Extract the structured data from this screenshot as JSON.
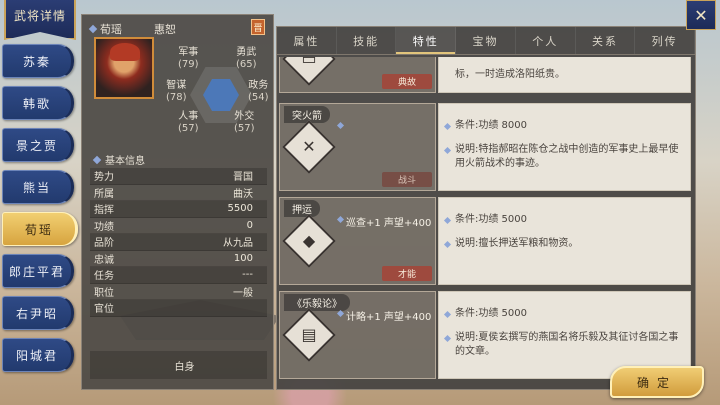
{
  "window": {
    "title": "武将详情"
  },
  "generals": [
    {
      "name": "苏秦",
      "active": false
    },
    {
      "name": "韩歌",
      "active": false
    },
    {
      "name": "景之贾",
      "active": false
    },
    {
      "name": "熊当",
      "active": false
    },
    {
      "name": "荀瑶",
      "active": true
    },
    {
      "name": "郎庄平君",
      "active": false
    },
    {
      "name": "右尹昭",
      "active": false
    },
    {
      "name": "阳城君",
      "active": false
    }
  ],
  "profile": {
    "name": "荀瑶",
    "courtesy_name": "惠恕",
    "state_badge": "晋",
    "stats": {
      "military": {
        "label": "军事",
        "value": "(79)"
      },
      "bravery": {
        "label": "勇武",
        "value": "(65)"
      },
      "strategy": {
        "label": "智谋",
        "value": "(78)"
      },
      "politics": {
        "label": "政务",
        "value": "(54)"
      },
      "personnel": {
        "label": "人事",
        "value": "(57)"
      },
      "diplomacy": {
        "label": "外交",
        "value": "(57)"
      }
    },
    "basic_info_title": "基本信息",
    "attributes": [
      {
        "label": "势力",
        "value": "晋国"
      },
      {
        "label": "所属",
        "value": "曲沃"
      },
      {
        "label": "指挥",
        "value": "5500"
      },
      {
        "label": "功绩",
        "value": "0"
      },
      {
        "label": "品阶",
        "value": "从九品"
      },
      {
        "label": "忠诚",
        "value": "100"
      },
      {
        "label": "任务",
        "value": "---"
      },
      {
        "label": "职位",
        "value": "一般"
      },
      {
        "label": "官位",
        "value": ""
      }
    ],
    "status": "白身"
  },
  "tabs": [
    {
      "label": "属性",
      "active": false
    },
    {
      "label": "技能",
      "active": false
    },
    {
      "label": "特性",
      "active": true
    },
    {
      "label": "宝物",
      "active": false
    },
    {
      "label": "个人",
      "active": false
    },
    {
      "label": "关系",
      "active": false
    },
    {
      "label": "列传",
      "active": false
    }
  ],
  "traits": [
    {
      "name": "",
      "icon": "scroll-icon",
      "bonus": "",
      "category": "典故",
      "condition": "",
      "description": "标，一时造成洛阳纸贵。"
    },
    {
      "name": "突火箭",
      "icon": "crossed-swords-icon",
      "bonus": "",
      "category": "战斗",
      "condition": "条件:功绩 8000",
      "description": "说明:特指郝昭在陈仓之战中创造的军事史上最早使用火箭战术的事迹。"
    },
    {
      "name": "押运",
      "icon": "document-icon",
      "bonus": "巡查+1 声望+400",
      "category": "才能",
      "condition": "条件:功绩 5000",
      "description": "说明:擅长押送军粮和物资。"
    },
    {
      "name": "《乐毅论》",
      "icon": "book-icon",
      "bonus": "计略+1 声望+400",
      "category": "",
      "condition": "条件:功绩 5000",
      "description": "说明:夏侯玄撰写的燕国名将乐毅及其征讨各国之事的文章。"
    }
  ],
  "buttons": {
    "close": "✕",
    "confirm": "确定"
  }
}
